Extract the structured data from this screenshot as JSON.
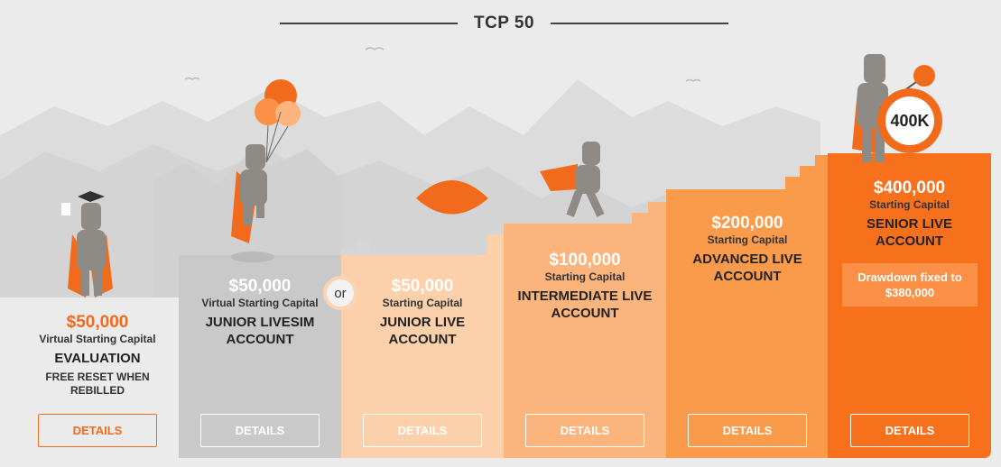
{
  "header": {
    "title": "TCP 50"
  },
  "plans": [
    {
      "amount": "$50,000",
      "subtitle": "Virtual Starting Capital",
      "name": "EVALUATION",
      "extra": "FREE RESET WHEN REBILLED",
      "button": "DETAILS"
    },
    {
      "amount": "$50,000",
      "subtitle": "Virtual Starting Capital",
      "name": "JUNIOR LIVESIM ACCOUNT",
      "button": "DETAILS"
    },
    {
      "amount": "$50,000",
      "subtitle": "Starting Capital",
      "name": "JUNIOR LIVE ACCOUNT",
      "button": "DETAILS"
    },
    {
      "amount": "$100,000",
      "subtitle": "Starting Capital",
      "name": "INTERMEDIATE LIVE ACCOUNT",
      "button": "DETAILS"
    },
    {
      "amount": "$200,000",
      "subtitle": "Starting Capital",
      "name": "ADVANCED LIVE ACCOUNT",
      "button": "DETAILS"
    },
    {
      "amount": "$400,000",
      "subtitle": "Starting Capital",
      "name": "SENIOR LIVE ACCOUNT",
      "note": "Drawdown fixed to $380,000",
      "button": "DETAILS"
    }
  ],
  "or_label": "or",
  "badge_label": "400K",
  "colors": {
    "background": "#ebebeb",
    "accent": "#f26b1d",
    "step_gray": "#c9c9c9",
    "step_1": "#fcd0aa",
    "step_2": "#fbb47c",
    "step_3": "#fa9a4b",
    "step_4": "#f7711c"
  }
}
